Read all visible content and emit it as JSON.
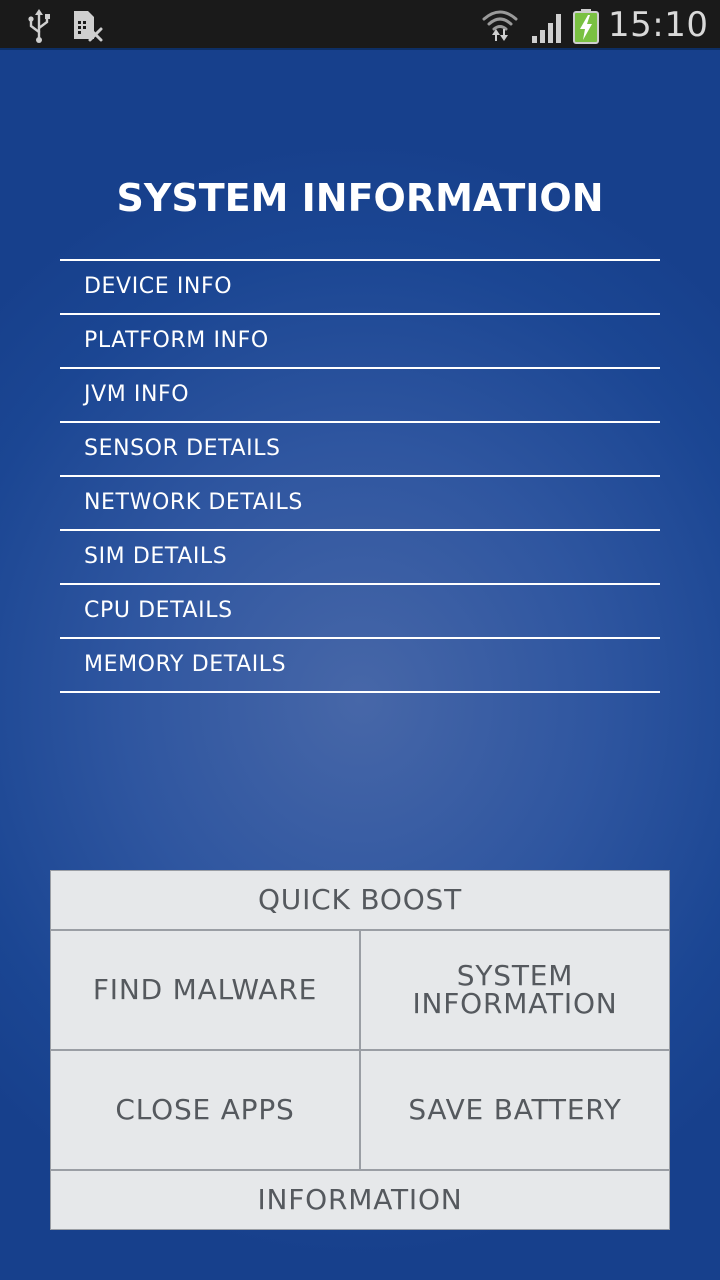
{
  "status_bar": {
    "time": "15:10",
    "icons": [
      "usb-icon",
      "sim-missing-icon",
      "wifi-icon",
      "signal-icon",
      "battery-charging-icon"
    ],
    "battery_color": "#7ac142"
  },
  "page": {
    "title": "SYSTEM INFORMATION"
  },
  "info_list": {
    "items": [
      {
        "label": "DEVICE INFO"
      },
      {
        "label": "PLATFORM INFO"
      },
      {
        "label": "JVM INFO"
      },
      {
        "label": "SENSOR DETAILS"
      },
      {
        "label": "NETWORK DETAILS"
      },
      {
        "label": "SIM DETAILS"
      },
      {
        "label": "CPU DETAILS"
      },
      {
        "label": "MEMORY DETAILS"
      }
    ]
  },
  "buttons": {
    "quick_boost": "QUICK BOOST",
    "find_malware": "FIND MALWARE",
    "system_information": "SYSTEM INFORMATION",
    "close_apps": "CLOSE APPS",
    "save_battery": "SAVE BATTERY",
    "information": "INFORMATION"
  },
  "colors": {
    "background": "#2f56a0",
    "button_face": "#e6e8ea",
    "button_text": "#55595e",
    "status_bar": "#1a1a1a"
  }
}
